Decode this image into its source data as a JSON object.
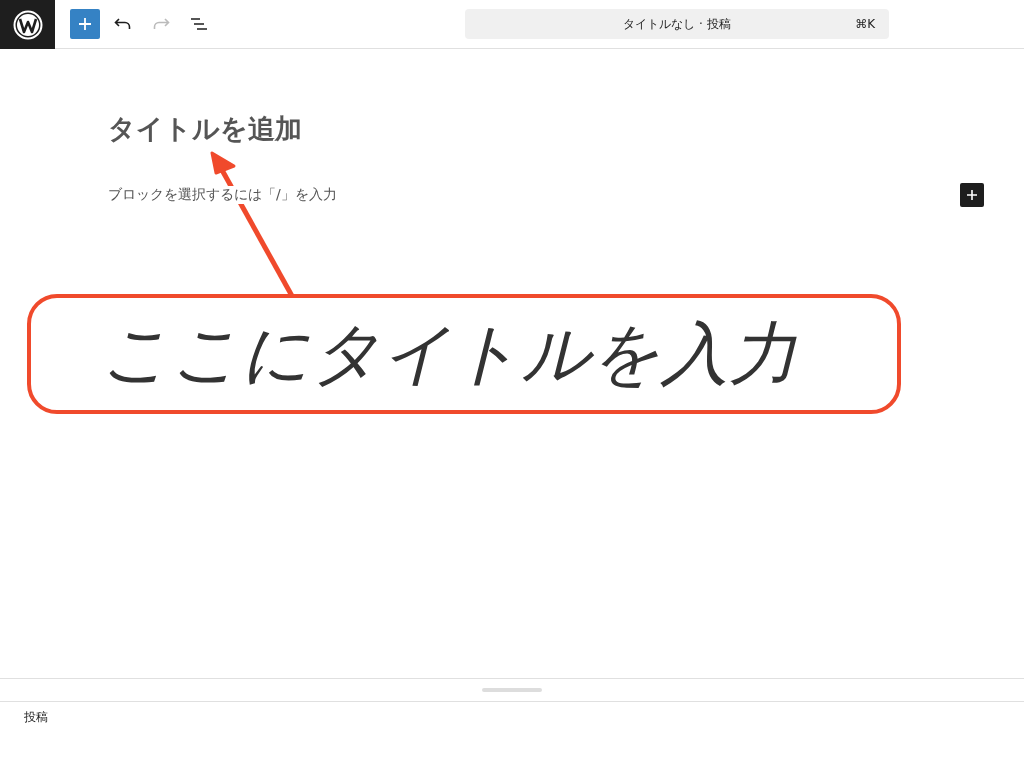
{
  "toolbar": {
    "undo_disabled": false,
    "redo_disabled": true
  },
  "command_bar": {
    "title": "タイトルなし · 投稿",
    "shortcut": "⌘K"
  },
  "editor": {
    "title_placeholder": "タイトルを追加",
    "block_placeholder": "ブロックを選択するには「/」を入力"
  },
  "annotation": {
    "text": "ここにタイトルを入力"
  },
  "breadcrumb": "投稿"
}
